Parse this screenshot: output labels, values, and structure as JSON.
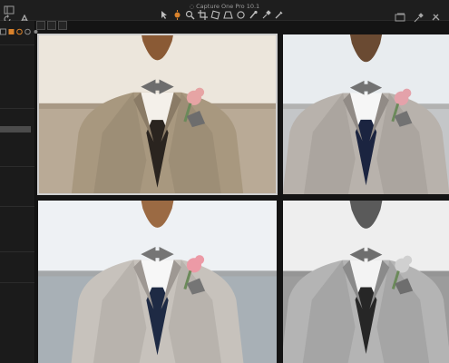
{
  "window": {
    "title": "Capture One Pro 10.1",
    "title_icon": "camera-icon"
  },
  "toolbar": {
    "left_icons": [
      "sidebar-toggle-icon",
      "rotate-icon",
      "text-icon"
    ],
    "cursor_tools": [
      "select-cursor-icon",
      "pan-icon",
      "loupe-icon",
      "crop-icon",
      "straighten-icon",
      "keystone-icon",
      "spot-removal-icon",
      "mask-brush-icon",
      "picker-icon",
      "annotate-icon"
    ],
    "right_icons": [
      "viewer-icon",
      "picker-eyedropper-icon",
      "settings-icon"
    ]
  },
  "colors": {
    "accent": "#d9822b",
    "selection": "#cfcfcf"
  },
  "browser": {
    "images": [
      {
        "variant": "warm",
        "selected": true
      },
      {
        "variant": "cool-contrast",
        "selected": false
      },
      {
        "variant": "cool",
        "selected": false
      },
      {
        "variant": "monochrome",
        "selected": false
      }
    ]
  }
}
